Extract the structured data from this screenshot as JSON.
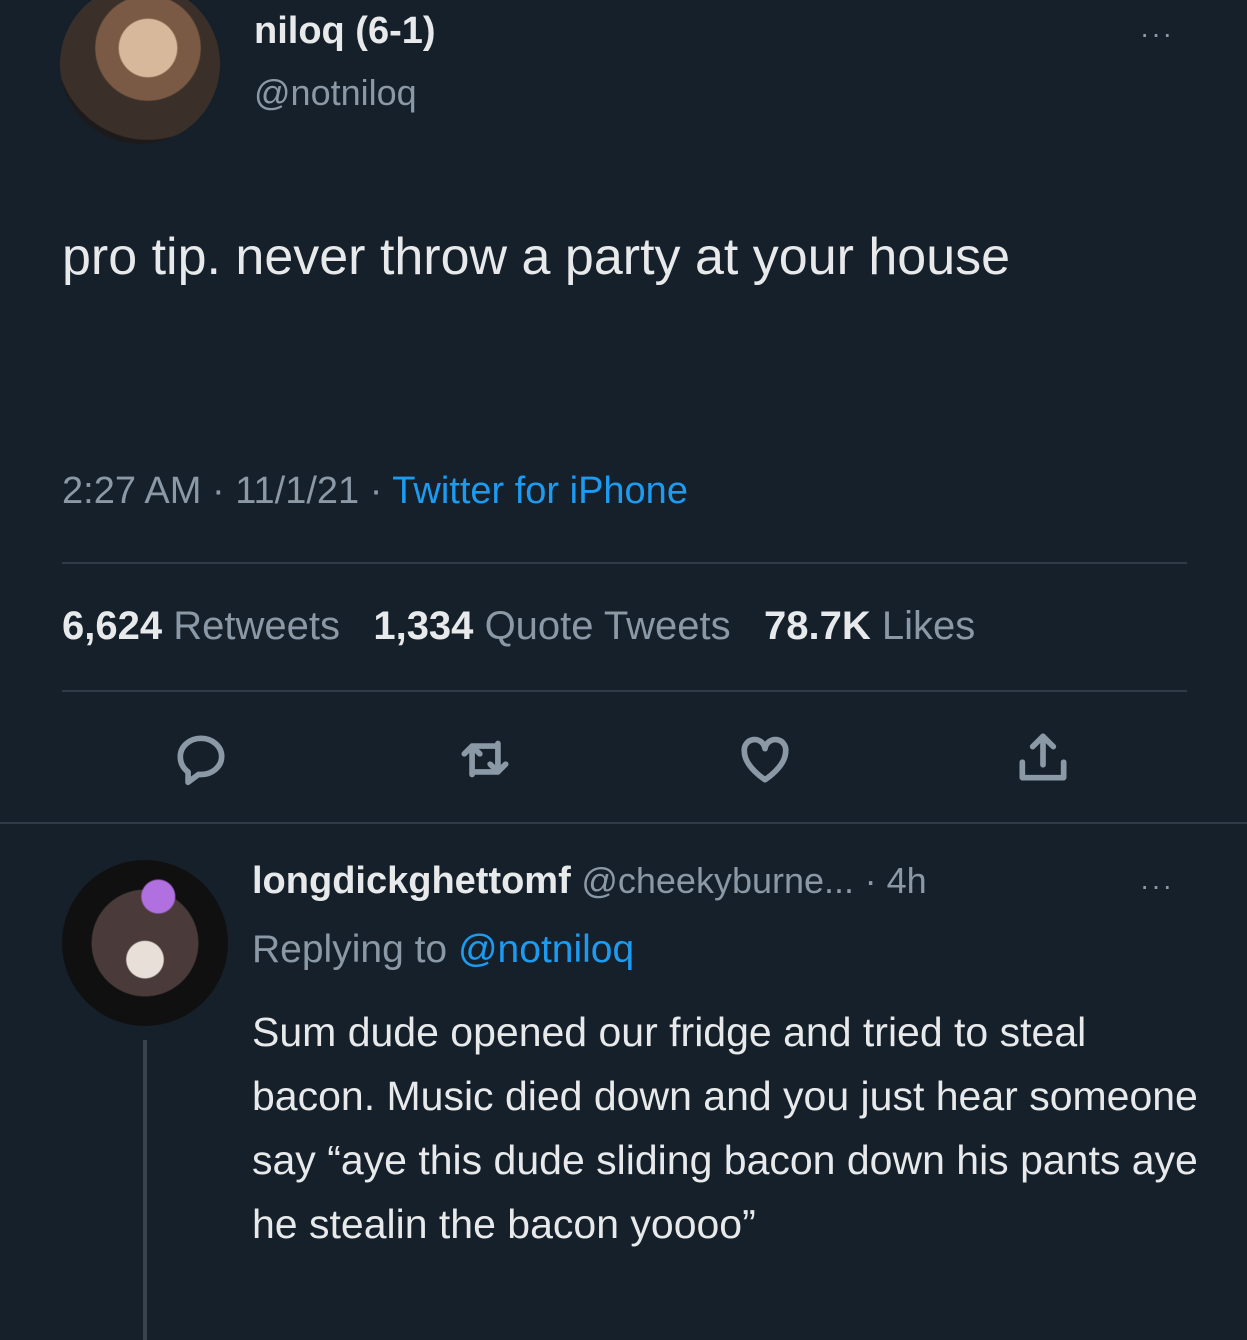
{
  "tweet": {
    "display_name": "niloq (6-1)",
    "handle": "@notniloq",
    "text": "pro tip. never throw a party at your house",
    "time": "2:27 AM",
    "date": "11/1/21",
    "source": "Twitter for iPhone",
    "retweets_count": "6,624",
    "retweets_label": "Retweets",
    "quotes_count": "1,334",
    "quotes_label": "Quote Tweets",
    "likes_count": "78.7K",
    "likes_label": "Likes",
    "more": "···"
  },
  "reply": {
    "display_name": "longdickghettomf",
    "handle": "@cheekyburne...",
    "age": "4h",
    "replying_label": "Replying to",
    "replying_handle": "@notniloq",
    "text": "Sum dude opened our fridge and tried to steal bacon. Music died down and you just hear someone say “aye this dude sliding bacon down his pants aye he stealin the bacon yoooo”",
    "more": "···"
  },
  "icons": [
    "reply-icon",
    "retweet-icon",
    "like-icon",
    "share-icon"
  ],
  "colors": {
    "background": "#15202b",
    "link": "#1d9bf0",
    "muted": "#8b98a5"
  }
}
